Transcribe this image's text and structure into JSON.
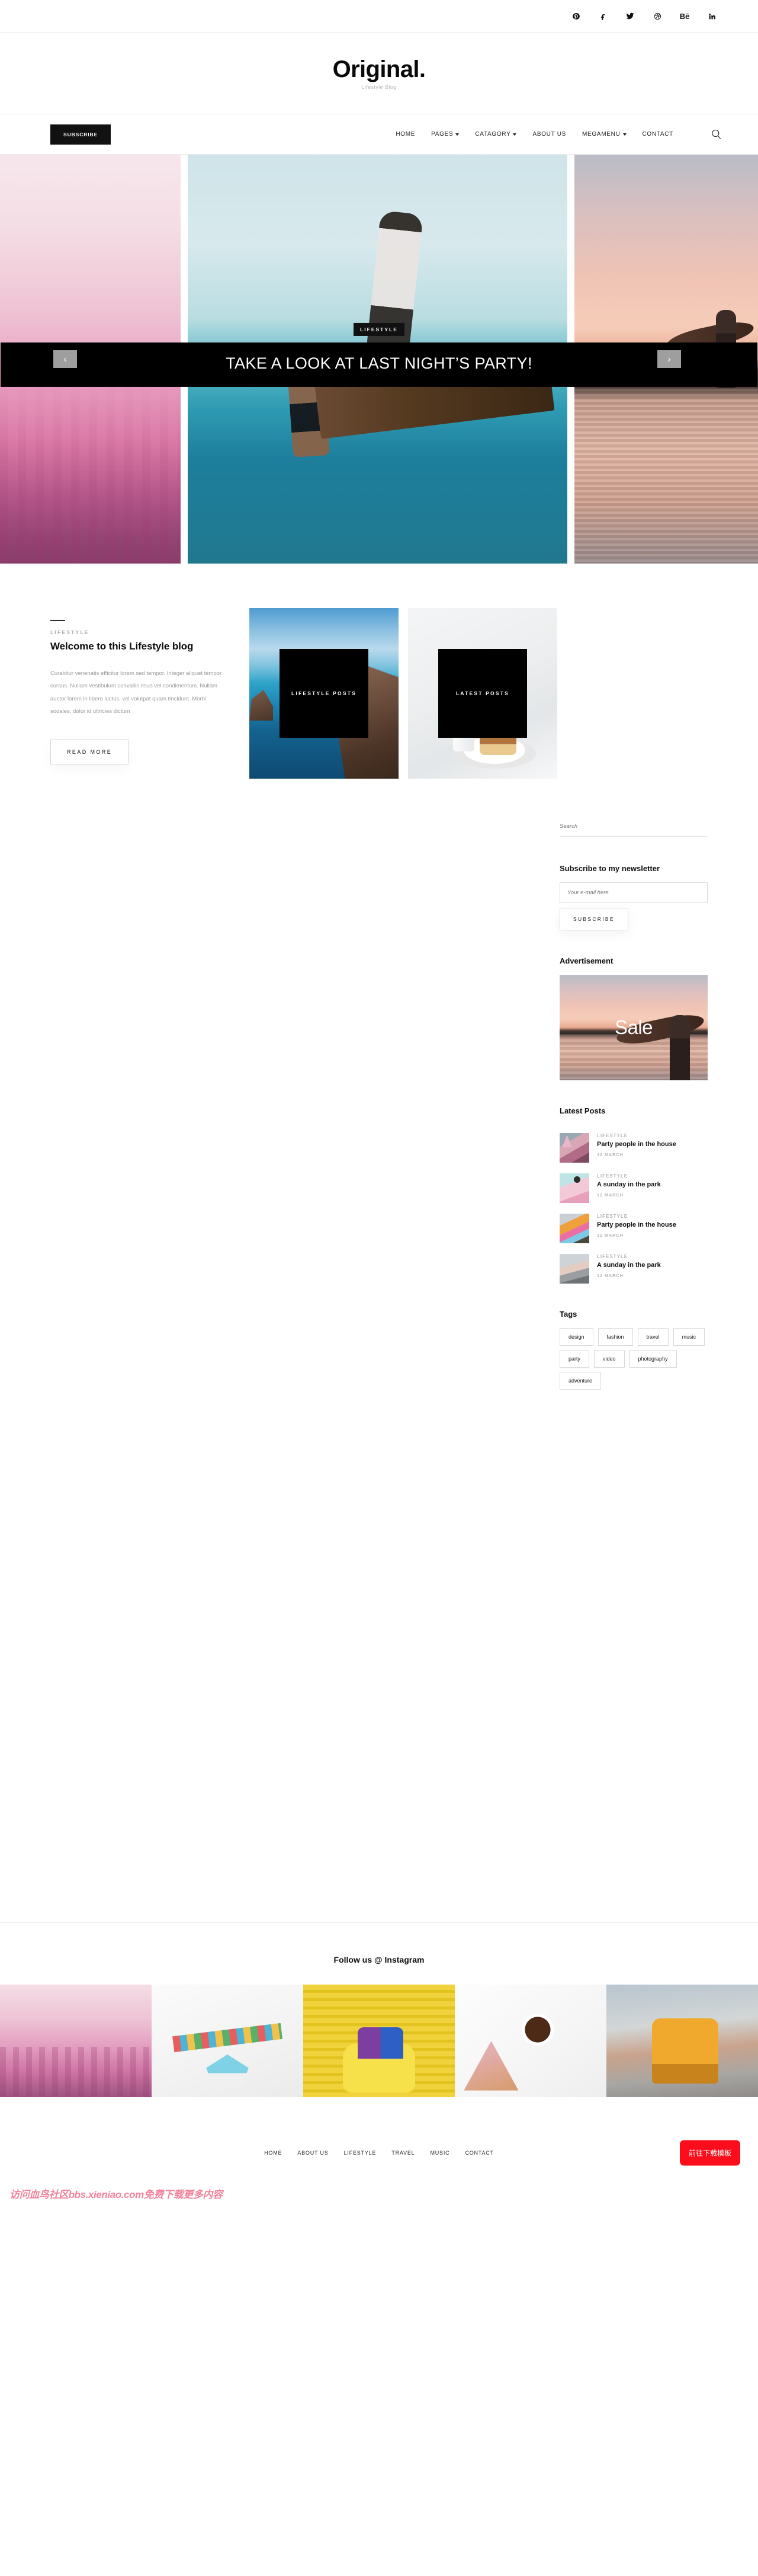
{
  "topbar": {
    "social": [
      {
        "name": "pinterest-icon",
        "glyph": "P"
      },
      {
        "name": "facebook-icon",
        "glyph": "f"
      },
      {
        "name": "twitter-icon",
        "glyph": "t"
      },
      {
        "name": "dribbble-icon",
        "glyph": "d"
      },
      {
        "name": "behance-icon",
        "glyph": "Bē"
      },
      {
        "name": "linkedin-icon",
        "glyph": "in"
      }
    ]
  },
  "brand": {
    "title": "Original.",
    "subtitle": "Lifestyle Blog"
  },
  "nav": {
    "subscribe_label": "SUBSCRIBE",
    "items": [
      {
        "label": "HOME",
        "caret": false
      },
      {
        "label": "PAGES",
        "caret": true
      },
      {
        "label": "CATAGORY",
        "caret": true
      },
      {
        "label": "ABOUT US",
        "caret": false
      },
      {
        "label": "MEGAMENU",
        "caret": true
      },
      {
        "label": "CONTACT",
        "caret": false
      }
    ],
    "search_icon": "search-icon"
  },
  "hero": {
    "prev_label": "‹",
    "next_label": "›",
    "category": "LIFESTYLE",
    "title": "TAKE A LOOK AT LAST NIGHT’S PARTY!"
  },
  "welcome": {
    "eyebrow": "LIFESTYLE",
    "title": "Welcome to this Lifestyle blog",
    "body": "Curabitur venenatis efficitur lorem sed tempor. Integer aliquet tempor cursus. Nullam vestibulum convallis risus vel condimentum. Nullam auctor lorem in libero luctus, vel volutpat quam tincidunt. Morbi sodales, dolor id ultricies dictum",
    "read_more_label": "READ MORE",
    "cards": [
      {
        "label": "LIFESTYLE POSTS"
      },
      {
        "label": "LATEST POSTS"
      }
    ]
  },
  "sidebar": {
    "search_placeholder": "Search",
    "newsletter": {
      "title": "Subscribe to my newsletter",
      "email_placeholder": "Your e-mail here",
      "button_label": "SUBSCRIBE"
    },
    "advertisement": {
      "title": "Advertisement",
      "banner_text": "Sale"
    },
    "latest_posts": {
      "title": "Latest Posts",
      "items": [
        {
          "category": "LIFESTYLE",
          "title": "Party people in the house",
          "date": "12 MARCH",
          "thumb": "th-kids"
        },
        {
          "category": "LIFESTYLE",
          "title": "A sunday in the park",
          "date": "12 MARCH",
          "thumb": "th-sweets"
        },
        {
          "category": "LIFESTYLE",
          "title": "Party people in the house",
          "date": "12 MARCH",
          "thumb": "th-balloons"
        },
        {
          "category": "LIFESTYLE",
          "title": "A sunday in the park",
          "date": "12 MARCH",
          "thumb": "th-street"
        }
      ]
    },
    "tags": {
      "title": "Tags",
      "items": [
        "design",
        "fashion",
        "travel",
        "music",
        "party",
        "video",
        "photography",
        "adventure"
      ]
    }
  },
  "instagram": {
    "title": "Follow us @ Instagram",
    "cells": [
      "ig1",
      "ig2",
      "ig3",
      "ig4",
      "ig5"
    ]
  },
  "footer": {
    "links": [
      "HOME",
      "ABOUT US",
      "LIFESTYLE",
      "TRAVEL",
      "MUSIC",
      "CONTACT"
    ],
    "download_label": "前往下载模板",
    "watermark": "访问血鸟社区bbs.xieniao.com免费下载更多内容",
    "accent": "#fb0d1b"
  }
}
